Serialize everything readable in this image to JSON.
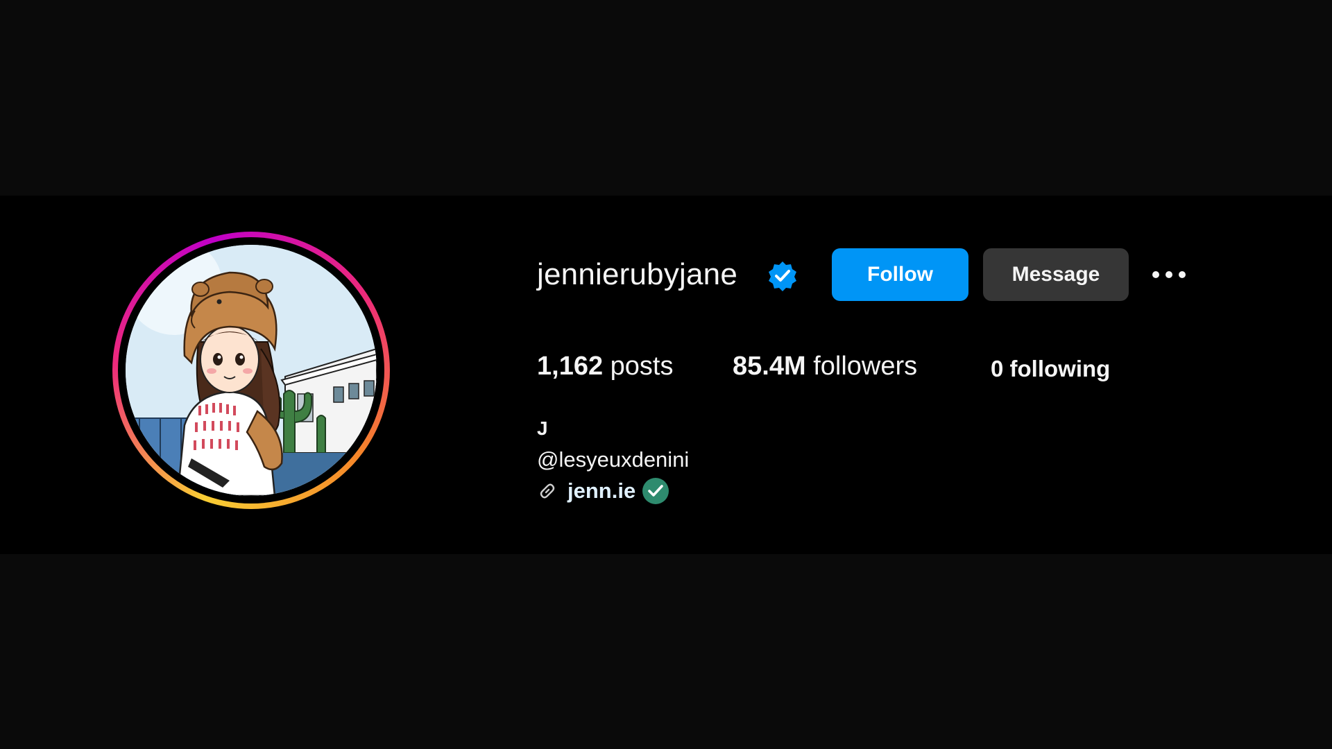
{
  "profile": {
    "username": "jennierubyjane",
    "verified": true,
    "avatar_description": "cartoon-avatar"
  },
  "actions": {
    "follow_label": "Follow",
    "message_label": "Message",
    "more_icon": "more-options-icon"
  },
  "stats": {
    "posts_count": "1,162",
    "posts_label": "posts",
    "followers_count": "85.4M",
    "followers_label": "followers",
    "following_text": "0 following"
  },
  "bio": {
    "name": "J",
    "handle": "@lesyeuxdenini",
    "link_text": "jenn.ie",
    "link_icon": "link-icon",
    "link_badge_icon": "check-circle-icon"
  },
  "colors": {
    "follow_button": "#0095f6",
    "message_button": "#363636",
    "verified_badge": "#0095f6",
    "link_check": "#2e8b6e",
    "background": "#000000"
  }
}
